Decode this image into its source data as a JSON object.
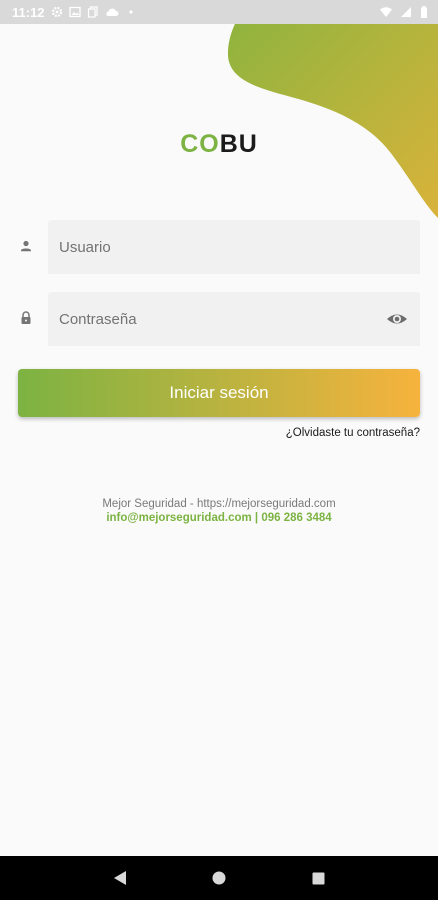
{
  "status_bar": {
    "time": "11:12"
  },
  "logo": {
    "part1": "CO",
    "part2": "BU"
  },
  "login_form": {
    "username_placeholder": "Usuario",
    "password_placeholder": "Contraseña",
    "login_button": "Iniciar sesión",
    "forgot_password": "¿Olvidaste tu contraseña?"
  },
  "footer": {
    "company": "Mejor Seguridad - https://mejorseguridad.com",
    "contact": "info@mejorseguridad.com | 096 286 3484"
  },
  "icons": {
    "username": "person-icon",
    "password": "lock-icon",
    "toggle_visibility": "eye-icon"
  },
  "colors": {
    "brand_green": "#7cb342",
    "brand_orange": "#f6b33d",
    "blob_green": "#8bb43f",
    "blob_yellow": "#d9b33a"
  }
}
